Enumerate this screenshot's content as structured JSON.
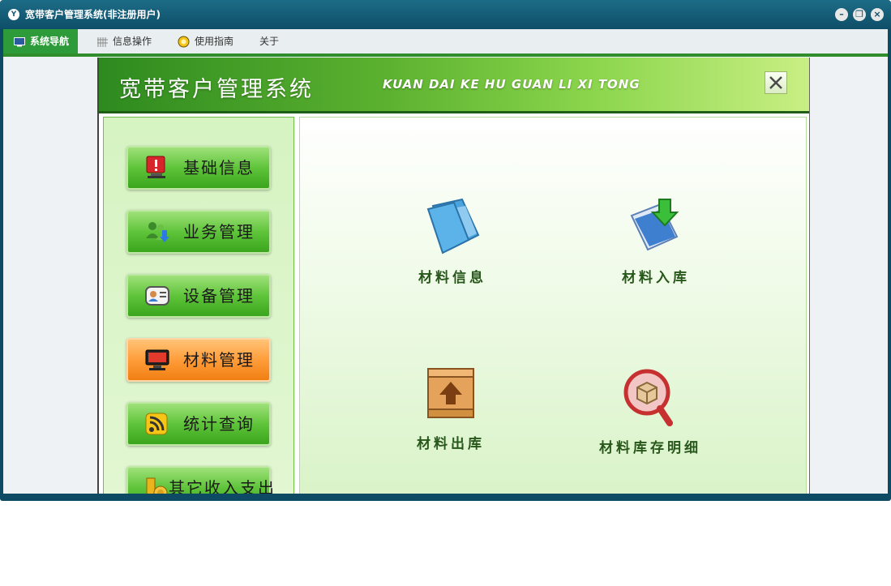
{
  "window": {
    "title": "宽带客户管理系统(非注册用户)",
    "app_icon_text": "Y"
  },
  "menu": [
    {
      "label": "系统导航",
      "active": true
    },
    {
      "label": "信息操作"
    },
    {
      "label": "使用指南"
    },
    {
      "label": "关于"
    }
  ],
  "banner": {
    "title": "宽带客户管理系统",
    "subtitle": "KUAN DAI KE HU GUAN LI XI TONG"
  },
  "nav": [
    {
      "label": "基础信息",
      "icon": "alert-monitor-icon"
    },
    {
      "label": "业务管理",
      "icon": "users-download-icon"
    },
    {
      "label": "设备管理",
      "icon": "contact-card-icon"
    },
    {
      "label": "材料管理",
      "icon": "monitor-icon",
      "active": true
    },
    {
      "label": "统计查询",
      "icon": "rss-icon"
    },
    {
      "label": "其它收入支出",
      "icon": "coins-icon"
    }
  ],
  "tiles": [
    {
      "label": "材料信息",
      "icon": "folder-icon"
    },
    {
      "label": "材料入库",
      "icon": "documents-import-icon"
    },
    {
      "label": "材料出库",
      "icon": "crate-export-icon"
    },
    {
      "label": "材料库存明细",
      "icon": "box-search-icon"
    }
  ],
  "colors": {
    "accent_green": "#2e9b3a",
    "active_orange": "#ff9d3a",
    "title_bar": "#0e4e68"
  }
}
